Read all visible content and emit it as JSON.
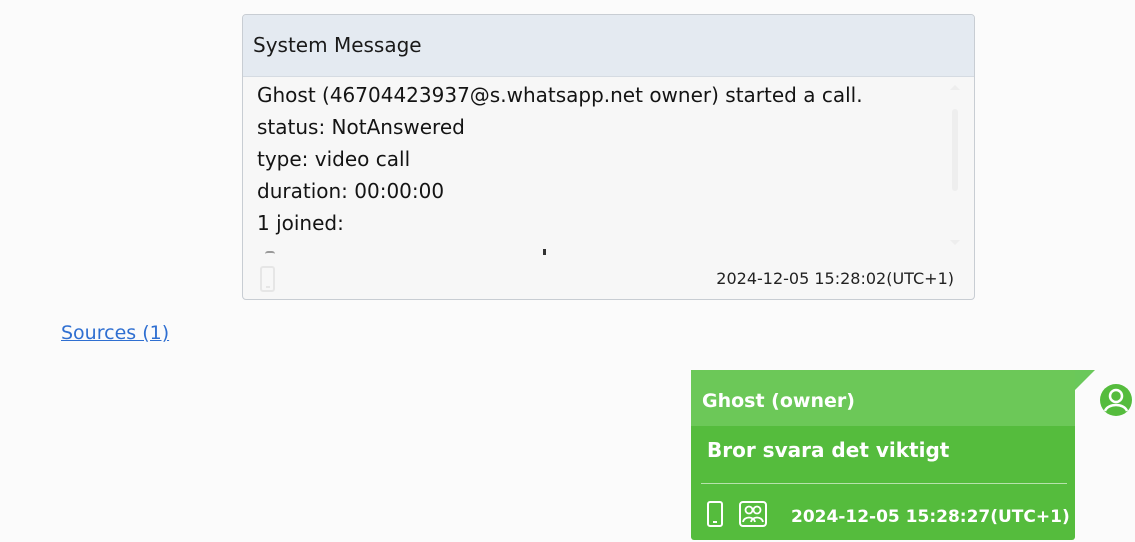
{
  "system_message": {
    "header": "System Message",
    "lines": [
      "Ghost (46704423937@s.whatsapp.net owner) started a call.",
      "status: NotAnswered",
      "type: video call",
      "duration: 00:00:00",
      "1 joined:"
    ],
    "timestamp": "2024-12-05 15:28:02(UTC+1)",
    "device_icon": "phone-icon"
  },
  "sources_link": "Sources (1)",
  "chat_message": {
    "sender": "Ghost (owner)",
    "text": "Bror svara det viktigt",
    "timestamp": "2024-12-05 15:28:27(UTC+1)",
    "icons": [
      "phone-icon",
      "group-icon"
    ],
    "bubble_color": "#55bc3d",
    "header_color": "#6cc858"
  },
  "avatar": {
    "icon": "user-avatar-icon",
    "color": "#55bc3d"
  }
}
